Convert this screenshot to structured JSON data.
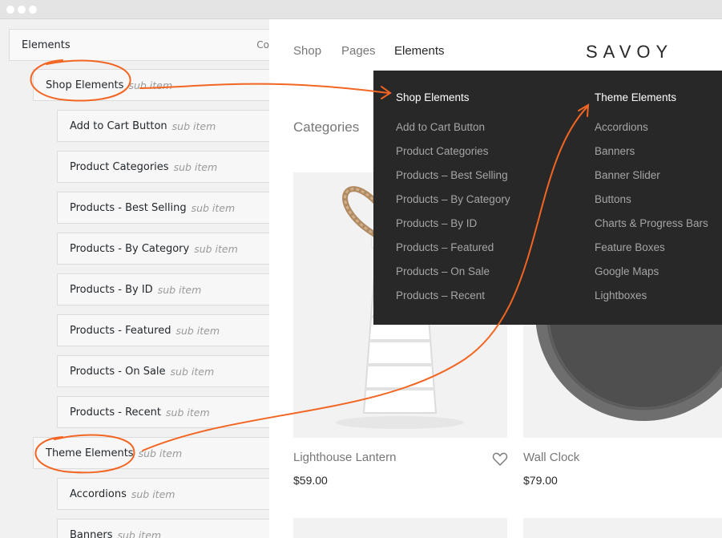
{
  "menu_editor": {
    "root_label": "Elements",
    "root_right_label": "Co",
    "items": [
      {
        "label": "Shop Elements",
        "sub": "sub item"
      },
      {
        "label": "Add to Cart Button",
        "sub": "sub item"
      },
      {
        "label": "Product Categories",
        "sub": "sub item"
      },
      {
        "label": "Products - Best Selling",
        "sub": "sub item"
      },
      {
        "label": "Products - By Category",
        "sub": "sub item"
      },
      {
        "label": "Products - By ID",
        "sub": "sub item"
      },
      {
        "label": "Products - Featured",
        "sub": "sub item"
      },
      {
        "label": "Products - On Sale",
        "sub": "sub item"
      },
      {
        "label": "Products - Recent",
        "sub": "sub item"
      },
      {
        "label": "Theme Elements",
        "sub": "sub item"
      },
      {
        "label": "Accordions",
        "sub": "sub item"
      },
      {
        "label": "Banners",
        "sub": "sub item"
      }
    ]
  },
  "site": {
    "nav": [
      "Shop",
      "Pages",
      "Elements"
    ],
    "logo": "SAVOY",
    "categories_heading": "Categories",
    "dropdown": {
      "shop_title": "Shop Elements",
      "shop_items": [
        "Add to Cart Button",
        "Product Categories",
        "Products – Best Selling",
        "Products – By Category",
        "Products – By ID",
        "Products – Featured",
        "Products – On Sale",
        "Products – Recent"
      ],
      "theme_title": "Theme Elements",
      "theme_items": [
        "Accordions",
        "Banners",
        "Banner Slider",
        "Buttons",
        "Charts & Progress Bars",
        "Feature Boxes",
        "Google Maps",
        "Lightboxes"
      ]
    },
    "products": [
      {
        "name": "Lighthouse Lantern",
        "price": "$59.00"
      },
      {
        "name": "Wall Clock",
        "price": "$79.00"
      }
    ]
  },
  "colors": {
    "annotation": "#f26522",
    "dropdown_bg": "#282828"
  }
}
